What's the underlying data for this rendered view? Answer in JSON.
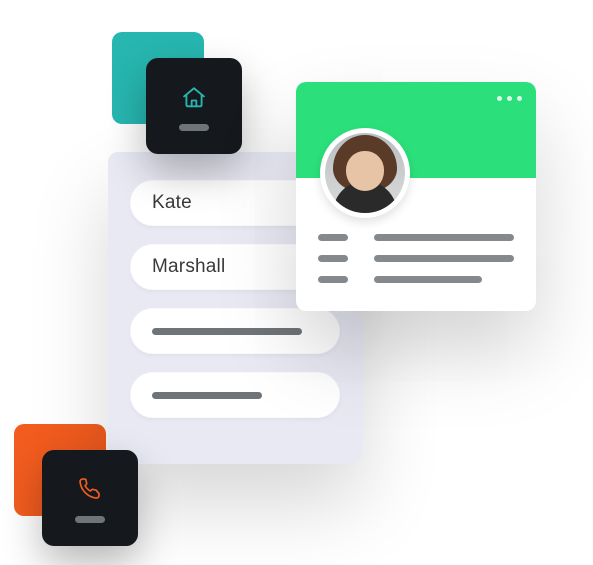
{
  "form": {
    "fields": [
      {
        "label": "Kate"
      },
      {
        "label": "Marshall"
      }
    ]
  },
  "icons": {
    "home": "home-icon",
    "phone": "phone-icon",
    "more": "more-icon"
  },
  "colors": {
    "teal": "#27b6b0",
    "orange": "#f25c1f",
    "green": "#2be07a",
    "dark": "#15181c"
  }
}
